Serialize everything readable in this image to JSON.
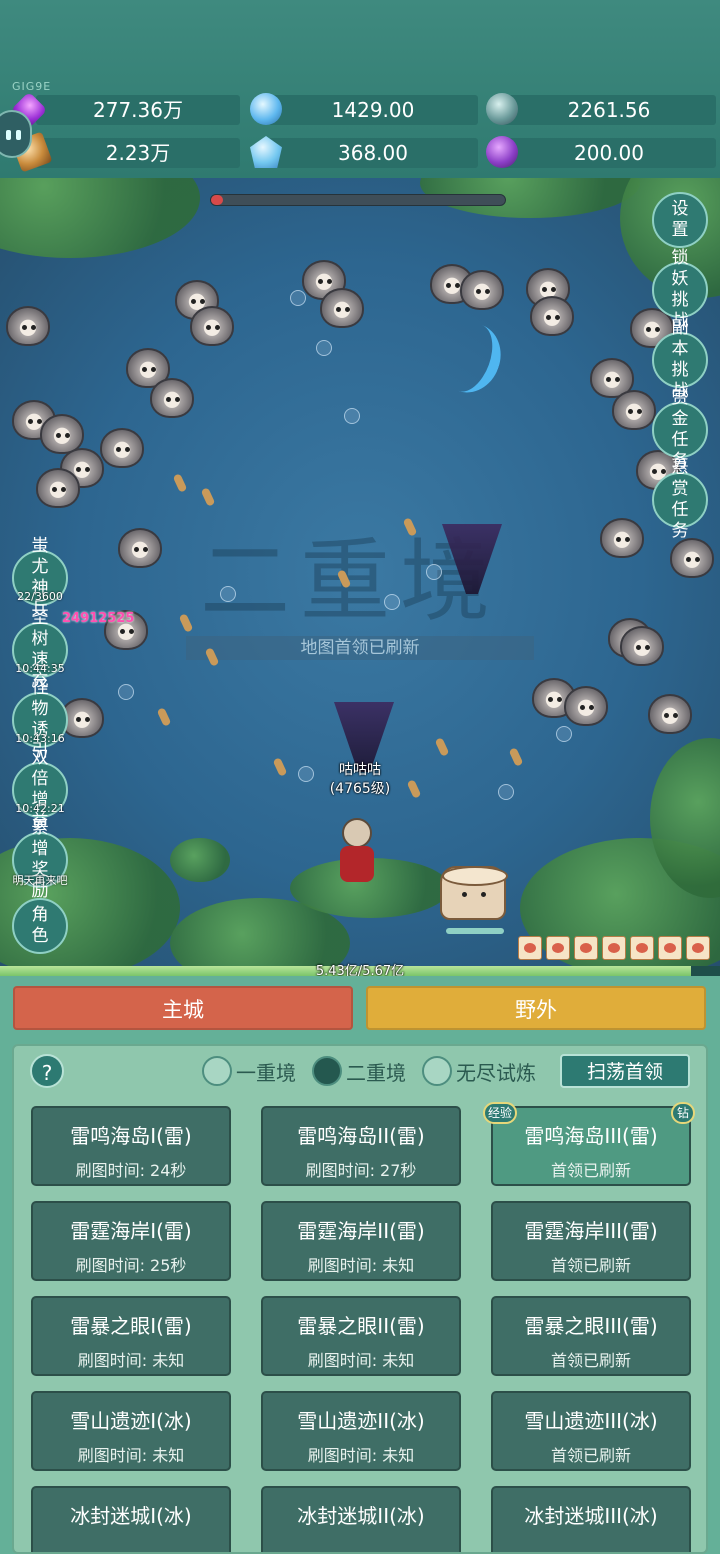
{
  "version_tag": "GIG9E",
  "resources": [
    {
      "icon": "purple-gem-icon",
      "value": "277.36万"
    },
    {
      "icon": "blue-crystal-icon",
      "value": "1429.00"
    },
    {
      "icon": "ore-icon",
      "value": "2261.56"
    },
    {
      "icon": "copper-ingot-icon",
      "value": "2.23万"
    },
    {
      "icon": "ice-crystal-icon",
      "value": "368.00"
    },
    {
      "icon": "purple-bag-icon",
      "value": "200.00"
    }
  ],
  "scene": {
    "boss_hp_fraction": 0.04,
    "realm_watermark": "二重境",
    "notice": "地图首领已刷新",
    "hero_name": "咕咕咕",
    "hero_level": "(4765级)",
    "damage_text": "24912525",
    "exp_fraction": 0.96,
    "exp_text": "5.43亿/5.67亿"
  },
  "right_buttons": [
    {
      "label": "设置"
    },
    {
      "label": "锁妖挑战"
    },
    {
      "label": "副本挑战"
    },
    {
      "label": "赏金任务"
    },
    {
      "label": "悬赏任务"
    }
  ],
  "left_buttons": [
    {
      "label": "蚩尤神兵",
      "sub": "22/3600"
    },
    {
      "label": "圣树速充",
      "sub": "10:44:35"
    },
    {
      "label": "怪物诱引",
      "sub": "10:43:16"
    },
    {
      "label": "双倍增益",
      "sub": "10:42:21"
    },
    {
      "label": "累增奖励",
      "sub": "明天再来吧"
    },
    {
      "label": "角色",
      "sub": ""
    }
  ],
  "tabs": {
    "main_city": "主城",
    "wild": "野外"
  },
  "panel": {
    "help": "?",
    "realms": [
      {
        "label": "一重境",
        "selected": false
      },
      {
        "label": "二重境",
        "selected": true
      },
      {
        "label": "无尽试炼",
        "selected": false
      }
    ],
    "sweep_button": "扫荡首领",
    "tag_exp": "经验",
    "tag_diamond": "钻",
    "maps": [
      {
        "name": "雷鸣海岛I(雷)",
        "status": "刷图时间: 24秒",
        "fresh": false
      },
      {
        "name": "雷鸣海岛II(雷)",
        "status": "刷图时间: 27秒",
        "fresh": false
      },
      {
        "name": "雷鸣海岛III(雷)",
        "status": "首领已刷新",
        "fresh": true
      },
      {
        "name": "雷霆海岸I(雷)",
        "status": "刷图时间: 25秒",
        "fresh": false
      },
      {
        "name": "雷霆海岸II(雷)",
        "status": "刷图时间: 未知",
        "fresh": false
      },
      {
        "name": "雷霆海岸III(雷)",
        "status": "首领已刷新",
        "fresh": false
      },
      {
        "name": "雷暴之眼I(雷)",
        "status": "刷图时间: 未知",
        "fresh": false
      },
      {
        "name": "雷暴之眼II(雷)",
        "status": "刷图时间: 未知",
        "fresh": false
      },
      {
        "name": "雷暴之眼III(雷)",
        "status": "首领已刷新",
        "fresh": false
      },
      {
        "name": "雪山遗迹I(冰)",
        "status": "刷图时间: 未知",
        "fresh": false
      },
      {
        "name": "雪山遗迹II(冰)",
        "status": "刷图时间: 未知",
        "fresh": false
      },
      {
        "name": "雪山遗迹III(冰)",
        "status": "首领已刷新",
        "fresh": false
      },
      {
        "name": "冰封迷城I(冰)",
        "status": "",
        "fresh": false
      },
      {
        "name": "冰封迷城II(冰)",
        "status": "",
        "fresh": false
      },
      {
        "name": "冰封迷城III(冰)",
        "status": "",
        "fresh": false
      }
    ]
  }
}
